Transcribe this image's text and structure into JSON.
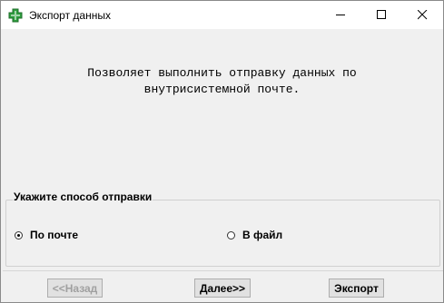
{
  "window": {
    "title": "Экспорт данных",
    "icon": "green-cross-icon",
    "accent_icon_color": "#2e9e3e"
  },
  "description": "Позволяет выполнить отправку данных по\nвнутрисистемной почте.",
  "send_method": {
    "legend": "Укажите способ отправки",
    "options": [
      {
        "label": "По почте",
        "selected": true
      },
      {
        "label": "В файл",
        "selected": false
      }
    ]
  },
  "buttons": {
    "back_label": "<<Назад",
    "back_enabled": false,
    "next_label": "Далее>>",
    "export_label": "Экспорт"
  }
}
